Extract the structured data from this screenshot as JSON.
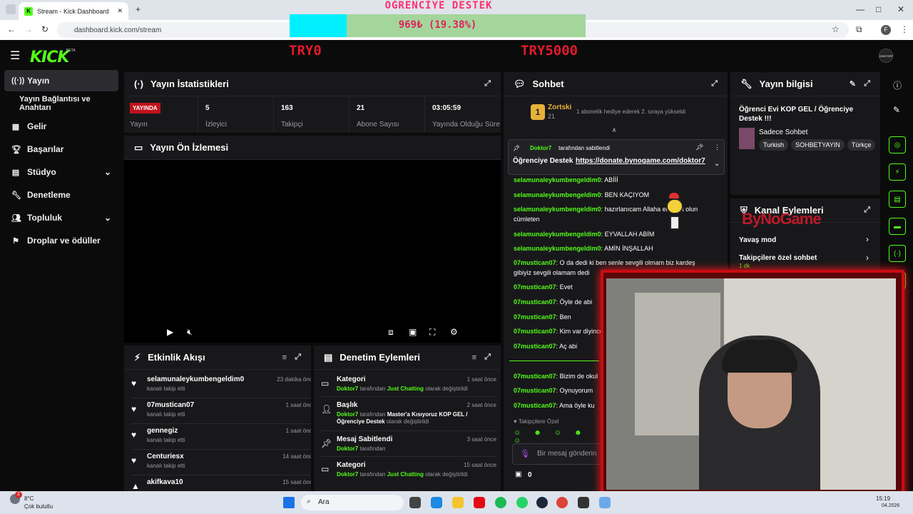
{
  "browser": {
    "tab_title": "Stream - Kick Dashboard",
    "url": "dashboard.kick.com/stream"
  },
  "overlay": {
    "title": "ÖĞRENCİYE DESTEK",
    "progress_text": "969₺ (19.38%)",
    "progress_fraction": 0.1938,
    "min_label": "TRY0",
    "max_label": "TRY5000"
  },
  "header": {
    "logo": "KICK",
    "beta": "BETA",
    "avatar": "DOKTOR7"
  },
  "sidebar": {
    "items": [
      {
        "label": "Yayın",
        "icon": "broadcast-icon",
        "active": true
      },
      {
        "label": "Yayın Bağlantısı ve Anahtarı",
        "icon": "",
        "active": false
      },
      {
        "label": "Gelir",
        "icon": "revenue-icon",
        "active": false
      },
      {
        "label": "Başarılar",
        "icon": "trophy-icon",
        "active": false
      },
      {
        "label": "Stüdyo",
        "icon": "studio-icon",
        "active": false
      },
      {
        "label": "Denetleme",
        "icon": "wrench-icon",
        "active": false
      },
      {
        "label": "Topluluk",
        "icon": "community-icon",
        "active": false
      },
      {
        "label": "Droplar ve ödüller",
        "icon": "drops-icon",
        "active": false
      }
    ]
  },
  "stats": {
    "title": "Yayın İstatistikleri",
    "live_badge": "YAYINDA",
    "live_label": "Yayın",
    "items": [
      {
        "value": "5",
        "label": "İzleyici"
      },
      {
        "value": "163",
        "label": "Takipçi"
      },
      {
        "value": "21",
        "label": "Abone Sayısı"
      },
      {
        "value": "03:05:59",
        "label": "Yayında Olduğu Süre"
      }
    ]
  },
  "preview": {
    "title": "Yayın Ön İzlemesi"
  },
  "activity": {
    "title": "Etkinlik Akışı",
    "items": [
      {
        "name": "selamunaleykumbengeldim0",
        "action": "kanalı takip etti",
        "time": "23 dakika önce"
      },
      {
        "name": "07mustican07",
        "action": "kanalı takip etti",
        "time": "1 saat önce"
      },
      {
        "name": "gennegiz",
        "action": "kanalı takip etti",
        "time": "1 saat önce"
      },
      {
        "name": "Centuriesx",
        "action": "kanalı takip etti",
        "time": "14 saat önce"
      },
      {
        "name": "akifkava10",
        "action": "",
        "time": "15 saat önce"
      }
    ]
  },
  "moderation": {
    "title": "Denetim Eylemleri",
    "items": [
      {
        "title": "Kategori",
        "user": "Doktor7",
        "pre": "tarafından",
        "value": "Just Chatting",
        "post": "olarak değiştirildi",
        "time": "1 saat önce"
      },
      {
        "title": "Başlık",
        "user": "Doktor7",
        "pre": "tarafından",
        "value": "Master'a Kısıyoruz KOP GEL / Öğrenciye Destek",
        "post": "olarak değiştirildi",
        "time": "2 saat önce"
      },
      {
        "title": "Mesaj Sabitlendi",
        "user": "Doktor7",
        "pre": "tarafından",
        "value": "",
        "post": "",
        "time": "3 saat önce"
      },
      {
        "title": "Kategori",
        "user": "Doktor7",
        "pre": "tarafından",
        "value": "Just Chatting",
        "post": "olarak değiştirildi",
        "time": "15 saat önce"
      }
    ]
  },
  "chat": {
    "title": "Sohbet",
    "gift_user": "Zortski",
    "gift_count": "21",
    "gift_text": "1 abonelik hediye ederek 2. sıraya yükseldi",
    "pinned_user": "Doktor7",
    "pinned_by": "tarafından sabitlendi",
    "pinned_msg": "Öğrenciye Destek",
    "pinned_link": "https://donate.bynogame.com/doktor7",
    "messages": [
      {
        "user": "selamunaleykumbengeldim0",
        "text": "ABİİİ"
      },
      {
        "user": "selamunaleykumbengeldim0",
        "text": "BEN KAÇIYOM"
      },
      {
        "user": "selamunaleykumbengeldim0",
        "text": "hazırlanıcam Allaha emanet olun cümleten"
      },
      {
        "user": "selamunaleykumbengeldim0",
        "text": "EYVALLAH ABİM"
      },
      {
        "user": "selamunaleykumbengeldim0",
        "text": "AMİN İNŞALLAH"
      },
      {
        "user": "07mustican07",
        "text": "O da dedi ki ben senle sevgili olmam biz kardeş gibiyiz sevgili olamam dedi"
      },
      {
        "user": "07mustican07",
        "text": "Evet"
      },
      {
        "user": "07mustican07",
        "text": "Öyle de abi"
      },
      {
        "user": "07mustican07",
        "text": "Ben"
      },
      {
        "user": "07mustican07",
        "text": "Kim var diyince"
      },
      {
        "user": "07mustican07",
        "text": "Aç abi"
      },
      {
        "user": "07mustican07",
        "text": "Bizim de okul"
      },
      {
        "user": "07mustican07",
        "text": "Oynuyorum"
      },
      {
        "user": "07mustican07",
        "text": "Ama öyle ku"
      }
    ],
    "followers_only": "Takipçilere Özel",
    "input_placeholder": "Bir mesaj gönderin",
    "points": "0"
  },
  "stream_info": {
    "title": "Yayın bilgisi",
    "stream_title": "Öğrenci Evi KOP GEL / Öğrenciye Destek !!!",
    "category": "Sadece Sohbet",
    "tags": [
      "Turkish",
      "SOHBETYAYIN",
      "Türkçe"
    ]
  },
  "channel_actions": {
    "title": "Kanal Eylemleri",
    "slow_mode": "Yavaş mod",
    "followers_chat": "Takipçilere özel sohbet",
    "followers_chat_sub": "1 dk"
  },
  "sponsor": {
    "name": "ByNoGame"
  },
  "taskbar": {
    "weather_temp": "8°C",
    "weather_desc": "Çok bulutlu",
    "search": "Ara",
    "time": "15:19",
    "date": "04.2026",
    "notif": "2"
  }
}
